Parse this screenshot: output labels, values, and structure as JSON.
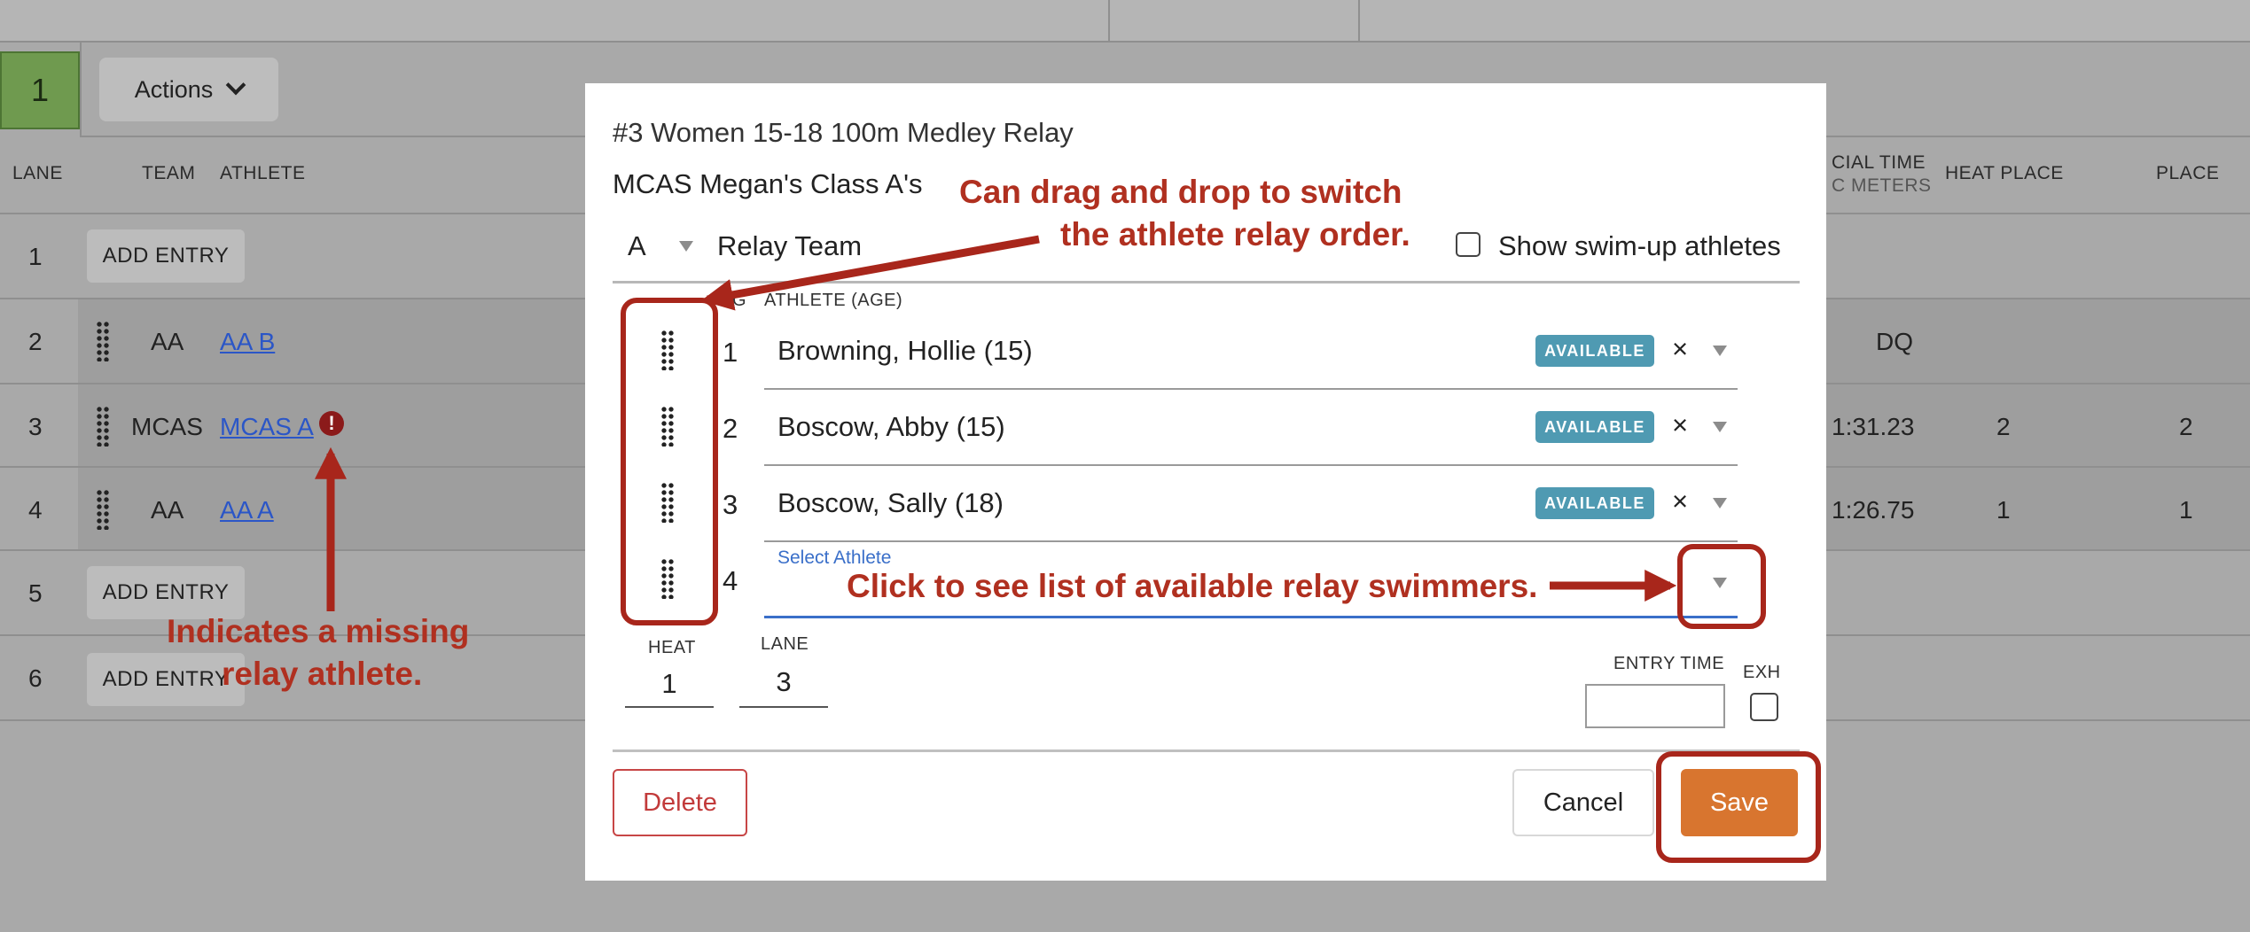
{
  "background": {
    "heat_number": "1",
    "actions_label": "Actions",
    "columns": {
      "lane": "LANE",
      "team": "TEAM",
      "athlete": "ATHLETE",
      "official_time": "CIAL TIME",
      "official_time_sub": "C METERS",
      "heat_place": "HEAT PLACE",
      "place": "PLACE"
    },
    "add_entry_label": "ADD ENTRY",
    "rows": [
      {
        "lane": "1"
      },
      {
        "lane": "2",
        "team": "AA",
        "athlete": "AA B",
        "time": "DQ"
      },
      {
        "lane": "3",
        "team": "MCAS",
        "athlete": "MCAS A",
        "warning": "!",
        "time": "1:31.23",
        "heat_place": "2",
        "place": "2"
      },
      {
        "lane": "4",
        "team": "AA",
        "athlete": "AA A",
        "time": "1:26.75",
        "heat_place": "1",
        "place": "1"
      },
      {
        "lane": "5"
      },
      {
        "lane": "6"
      }
    ]
  },
  "modal": {
    "title": "#3 Women 15-18 100m Medley Relay",
    "team_name": "MCAS Megan's Class A's",
    "relay_letter": "A",
    "relay_team_label": "Relay Team",
    "show_swimup_label": "Show swim-up athletes",
    "leg_header": "G",
    "athlete_header": "ATHLETE (AGE)",
    "legs": [
      {
        "num": "1",
        "name": "Browning, Hollie (15)",
        "status": "AVAILABLE",
        "clear": "×"
      },
      {
        "num": "2",
        "name": "Boscow, Abby (15)",
        "status": "AVAILABLE",
        "clear": "×"
      },
      {
        "num": "3",
        "name": "Boscow, Sally (18)",
        "status": "AVAILABLE",
        "clear": "×"
      },
      {
        "num": "4",
        "select_label": "Select Athlete"
      }
    ],
    "heat_label": "HEAT",
    "heat_value": "1",
    "lane_label": "LANE",
    "lane_value": "3",
    "entry_time_label": "ENTRY TIME",
    "entry_time_value": "",
    "exh_label": "EXH",
    "delete_label": "Delete",
    "cancel_label": "Cancel",
    "save_label": "Save"
  },
  "annotations": {
    "drag_note_line1": "Can drag and drop to switch",
    "drag_note_line2": "the athlete relay order.",
    "click_note": "Click to see list of available relay swimmers.",
    "missing_note_line1": "Indicates a missing",
    "missing_note_line2": "relay athlete.",
    "color": "#a8261b"
  }
}
